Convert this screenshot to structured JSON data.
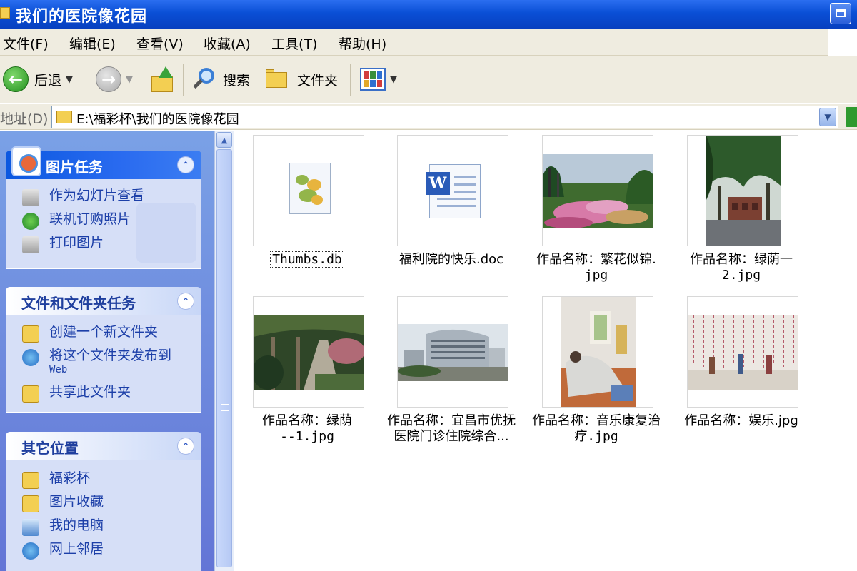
{
  "window": {
    "title": "我们的医院像花园"
  },
  "menu": {
    "items": [
      "文件(F)",
      "编辑(E)",
      "查看(V)",
      "收藏(A)",
      "工具(T)",
      "帮助(H)"
    ]
  },
  "toolbar": {
    "back_label": "后退",
    "search_label": "搜索",
    "folders_label": "文件夹"
  },
  "address": {
    "label": "地址(D)",
    "path": "E:\\福彩杯\\我们的医院像花园"
  },
  "panels": {
    "picture_tasks": {
      "title": "图片任务",
      "items": [
        "作为幻灯片查看",
        "联机订购照片",
        "打印图片"
      ]
    },
    "file_tasks": {
      "title": "文件和文件夹任务",
      "items": [
        "创建一个新文件夹",
        "将这个文件夹发布到",
        "Web",
        "共享此文件夹"
      ]
    },
    "other_places": {
      "title": "其它位置",
      "items": [
        "福彩杯",
        "图片收藏",
        "我的电脑",
        "网上邻居"
      ]
    }
  },
  "files": [
    {
      "name": "Thumbs.db"
    },
    {
      "name": "福利院的快乐.doc"
    },
    {
      "name_line1": "作品名称：繁花似锦.",
      "name_line2": "jpg"
    },
    {
      "name_line1": "作品名称：绿荫一",
      "name_line2": "2.jpg"
    },
    {
      "name_line1": "作品名称：绿荫",
      "name_line2": "--1.jpg"
    },
    {
      "name_line1": "作品名称：宜昌市优抚",
      "name_line2": "医院门诊住院综合..."
    },
    {
      "name_line1": "作品名称：音乐康复治",
      "name_line2": "疗.jpg"
    },
    {
      "name": "作品名称：娱乐.jpg"
    }
  ],
  "colors": {
    "title_bar": "#0a4fd6",
    "task_pane": "#6f8ee0",
    "link_text": "#1c3fa8"
  }
}
